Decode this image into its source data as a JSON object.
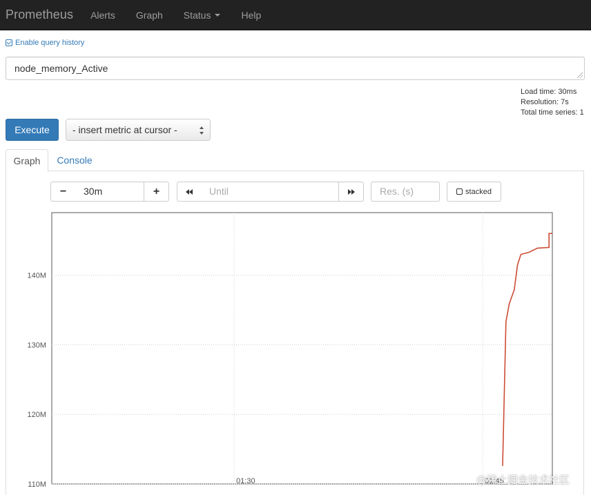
{
  "navbar": {
    "brand": "Prometheus",
    "items": [
      {
        "label": "Alerts"
      },
      {
        "label": "Graph"
      },
      {
        "label": "Status"
      },
      {
        "label": "Help"
      }
    ]
  },
  "query": {
    "history_toggle": "Enable query history",
    "expression": "node_memory_Active"
  },
  "stats": {
    "load_time": "Load time: 30ms",
    "resolution": "Resolution: 7s",
    "total_series": "Total time series: 1"
  },
  "actions": {
    "execute": "Execute",
    "metric_select": "- insert metric at cursor -"
  },
  "tabs": {
    "graph": "Graph",
    "console": "Console"
  },
  "controls": {
    "minus": "−",
    "range": "30m",
    "plus": "+",
    "until_placeholder": "Until",
    "resolution_placeholder": "Res. (s)",
    "stacked": "stacked"
  },
  "colors": {
    "navbar": "#222222",
    "accent": "#337ab7",
    "series": "#cc4c35"
  },
  "chart_data": {
    "type": "line",
    "y_ticks": [
      {
        "label": "110M",
        "value": 110000000
      },
      {
        "label": "120M",
        "value": 120000000
      },
      {
        "label": "130M",
        "value": 130000000
      },
      {
        "label": "140M",
        "value": 140000000
      }
    ],
    "x_ticks": [
      {
        "label": "01:30",
        "value": 90
      },
      {
        "label": "01:45",
        "value": 105
      }
    ],
    "xlim": [
      79,
      109.2
    ],
    "ylim": [
      110000000,
      149000000
    ],
    "grid": true,
    "series": [
      {
        "x": [
          106.2,
          106.4,
          106.4,
          106.6,
          106.6,
          106.9,
          106.9,
          107.1,
          107.1,
          107.3,
          107.3,
          107.8,
          107.8,
          108.3,
          108.3,
          109.0,
          109.0,
          109.2
        ],
        "values": [
          112600000,
          133300000,
          133300000,
          135900000,
          135900000,
          137900000,
          137900000,
          141500000,
          141500000,
          143000000,
          143000000,
          143300000,
          143300000,
          143900000,
          143900000,
          144000000,
          146000000,
          146000000
        ]
      }
    ]
  }
}
